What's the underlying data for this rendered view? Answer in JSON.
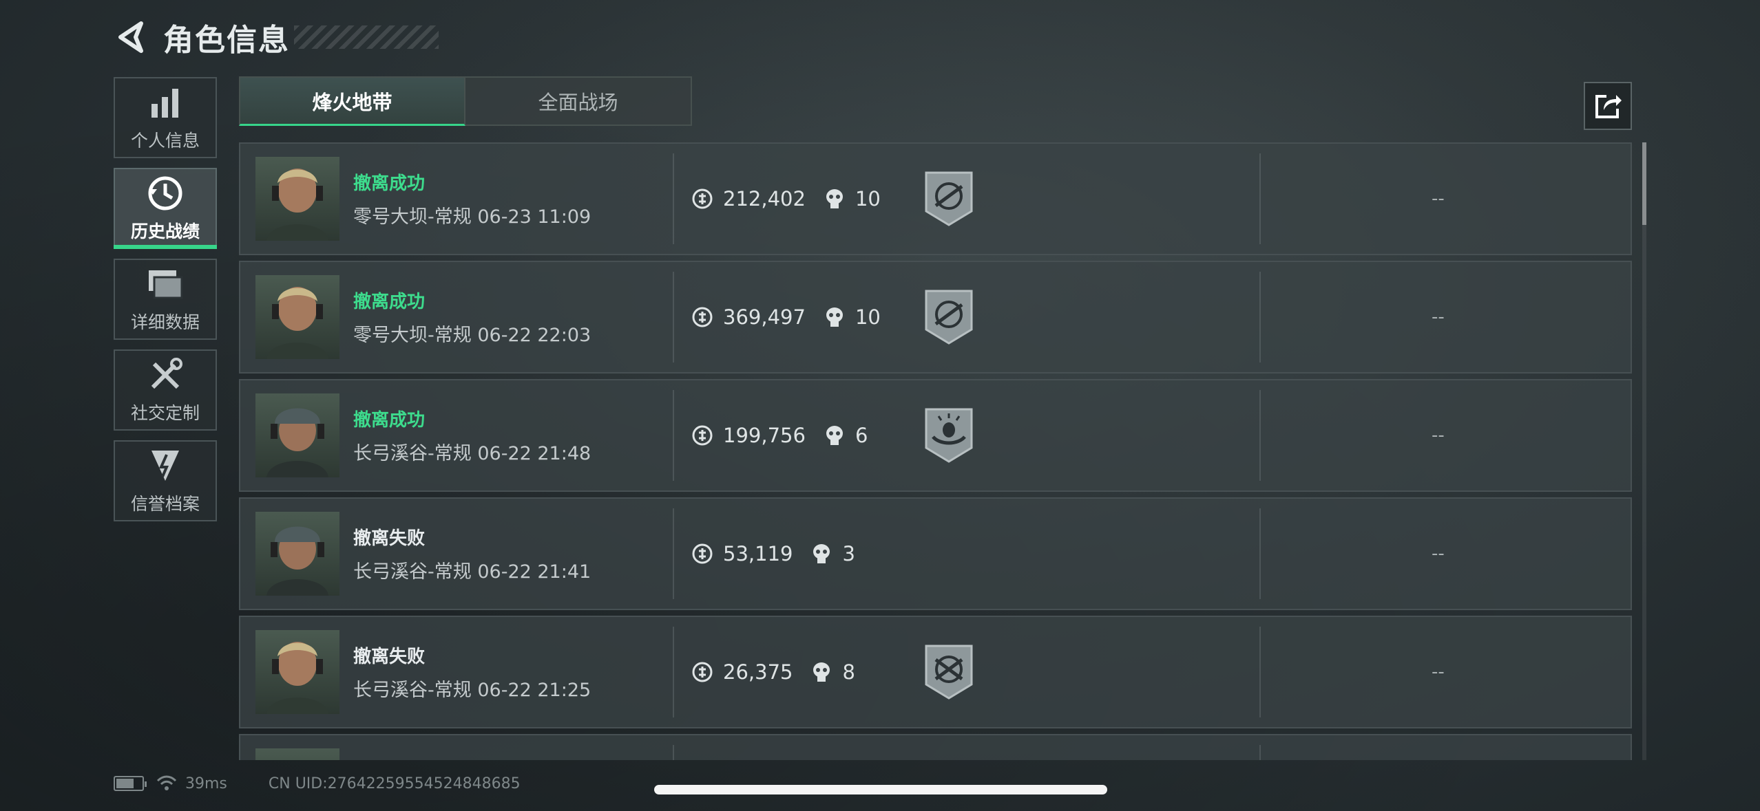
{
  "header": {
    "title": "角色信息"
  },
  "nav": {
    "items": [
      {
        "label": "个人信息",
        "icon": "bar-chart-icon"
      },
      {
        "label": "历史战绩",
        "icon": "history-clock-icon",
        "active": true
      },
      {
        "label": "详细数据",
        "icon": "folder-icon"
      },
      {
        "label": "社交定制",
        "icon": "tools-icon"
      },
      {
        "label": "信誉档案",
        "icon": "credit-shield-icon"
      }
    ]
  },
  "tabs": [
    {
      "label": "烽火地带",
      "active": true
    },
    {
      "label": "全面战场",
      "active": false
    }
  ],
  "records": [
    {
      "status": "撤离成功",
      "result": "success",
      "map": "零号大坝-常规",
      "time": "06-23 11:09",
      "value": "212,402",
      "kills": "10",
      "badge": "rifle-target-badge",
      "extra": "--"
    },
    {
      "status": "撤离成功",
      "result": "success",
      "map": "零号大坝-常规",
      "time": "06-22 22:03",
      "value": "369,497",
      "kills": "10",
      "badge": "rifle-target-badge",
      "extra": "--"
    },
    {
      "status": "撤离成功",
      "result": "success",
      "map": "长弓溪谷-常规",
      "time": "06-22 21:48",
      "value": "199,756",
      "kills": "6",
      "badge": "egg-nest-badge",
      "extra": "--"
    },
    {
      "status": "撤离失败",
      "result": "fail",
      "map": "长弓溪谷-常规",
      "time": "06-22 21:41",
      "value": "53,119",
      "kills": "3",
      "badge": "",
      "extra": "--"
    },
    {
      "status": "撤离失败",
      "result": "fail",
      "map": "长弓溪谷-常规",
      "time": "06-22 21:25",
      "value": "26,375",
      "kills": "8",
      "badge": "crossed-rifle-badge",
      "extra": "--"
    }
  ],
  "footer": {
    "ping": "39ms",
    "uid": "CN UID:276422595545248486​85"
  },
  "colors": {
    "accent": "#37d58a",
    "success": "#3ddc8d"
  }
}
